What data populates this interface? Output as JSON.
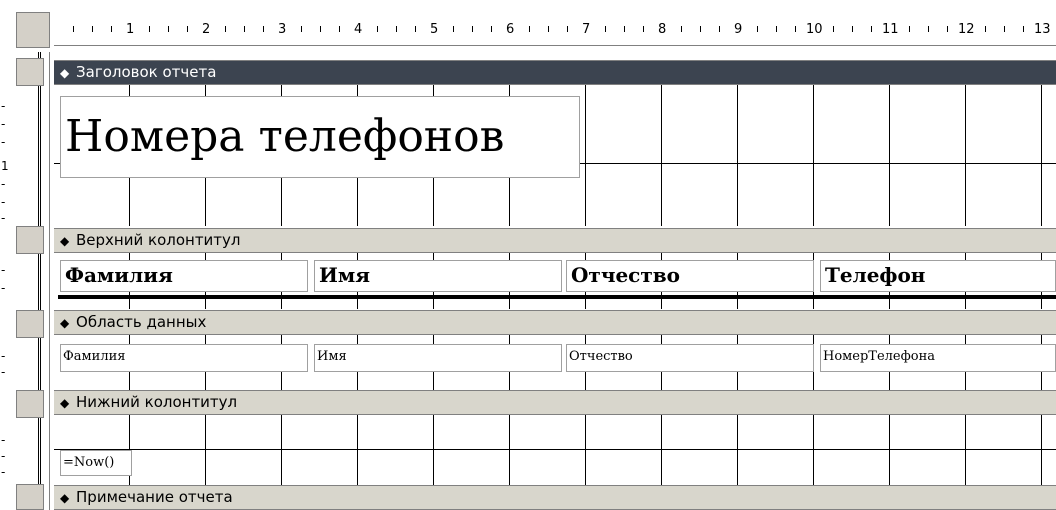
{
  "ruler": {
    "numbers": [
      "1",
      "2",
      "3",
      "4",
      "5",
      "6",
      "7",
      "8",
      "9",
      "10",
      "11",
      "12",
      "13"
    ]
  },
  "vertical_ruler": {
    "marks": [
      "-",
      "-",
      "-",
      "1",
      "-",
      "-",
      "-",
      "-",
      "-",
      "-",
      "-",
      "-",
      "-",
      "-"
    ]
  },
  "sections": {
    "report_header": "Заголовок отчета",
    "page_header": "Верхний колонтитул",
    "detail": "Область данных",
    "page_footer": "Нижний колонтитул",
    "report_footer": "Примечание отчета"
  },
  "section_marker": "◆",
  "report_title": "Номера телефонов",
  "column_labels": [
    "Фамилия",
    "Имя",
    "Отчество",
    "Телефон"
  ],
  "fields": [
    "Фамилия",
    "Имя",
    "Отчество",
    "НомерТелефона"
  ],
  "footer_expression": "=Now()"
}
